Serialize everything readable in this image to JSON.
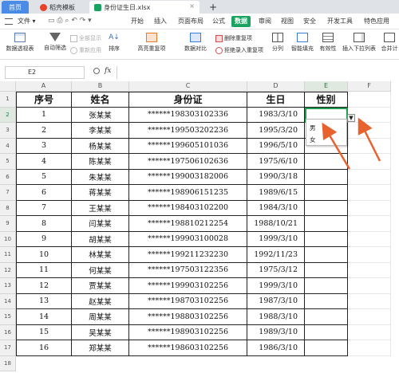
{
  "tabs": [
    {
      "label": "首页",
      "color": "#3a7be0"
    },
    {
      "label": "稻壳模板",
      "color": "#e8432a"
    },
    {
      "label": "身份证生日.xlsx",
      "color": "#1aa260"
    }
  ],
  "new_tab_symbol": "+",
  "menu": {
    "file": "文件",
    "items": [
      "开始",
      "插入",
      "页面布局",
      "公式",
      "数据",
      "审阅",
      "视图",
      "安全",
      "开发工具",
      "特色应用"
    ],
    "active": "数据"
  },
  "ribbon": {
    "pivot": "数据透视表",
    "autofilter": "自动筛选",
    "show_all": "全部显示",
    "reapply": "重新应用",
    "sort": "排序",
    "highlight_dup": "高亮重复项",
    "compare": "数据对比",
    "remove_dup": "删除重复项",
    "reject_dup": "拒绝录入重复项",
    "split": "分列",
    "smart_fill": "智能填充",
    "validity": "有效性",
    "dropdown_list": "插入下拉列表",
    "merge_calc": "合并计"
  },
  "formula_bar": {
    "cell_ref": "E2",
    "fx_label": "fx",
    "zoom_icon": "magnifier-icon"
  },
  "grid": {
    "col_headers": [
      "A",
      "B",
      "C",
      "D",
      "E",
      "F"
    ],
    "row_numbers": [
      "1",
      "2",
      "3",
      "4",
      "5",
      "6",
      "7",
      "8",
      "9",
      "10",
      "11",
      "12",
      "13",
      "14",
      "15",
      "16",
      "17",
      "18"
    ],
    "headers": [
      "序号",
      "姓名",
      "身份证",
      "生日",
      "性别"
    ],
    "rows": [
      [
        "1",
        "张某某",
        "******198303102336",
        "1983/3/10"
      ],
      [
        "2",
        "李某某",
        "******199503202236",
        "1995/3/20"
      ],
      [
        "3",
        "杨某某",
        "******199605101036",
        "1996/5/10"
      ],
      [
        "4",
        "陈某某",
        "******197506102636",
        "1975/6/10"
      ],
      [
        "5",
        "朱某某",
        "******199003182006",
        "1990/3/18"
      ],
      [
        "6",
        "蒋某某",
        "******198906151235",
        "1989/6/15"
      ],
      [
        "7",
        "王某某",
        "******198403102200",
        "1984/3/10"
      ],
      [
        "8",
        "闫某某",
        "******198810212254",
        "1988/10/21"
      ],
      [
        "9",
        "胡某某",
        "******199903100028",
        "1999/3/10"
      ],
      [
        "10",
        "林某某",
        "******199211232230",
        "1992/11/23"
      ],
      [
        "11",
        "何某某",
        "******197503122356",
        "1975/3/12"
      ],
      [
        "12",
        "贾某某",
        "******199903102256",
        "1999/3/10"
      ],
      [
        "13",
        "赵某某",
        "******198703102256",
        "1987/3/10"
      ],
      [
        "14",
        "周某某",
        "******198803102256",
        "1988/3/10"
      ],
      [
        "15",
        "吴某某",
        "******198903102256",
        "1989/3/10"
      ],
      [
        "16",
        "郑某某",
        "******198603102256",
        "1986/3/10"
      ]
    ]
  },
  "dropdown": {
    "options": [
      "男",
      "女"
    ],
    "button_symbol": "▼"
  },
  "colors": {
    "accent": "#1aa260",
    "arrow": "#e8622d",
    "selection": "#1e9e4b"
  }
}
